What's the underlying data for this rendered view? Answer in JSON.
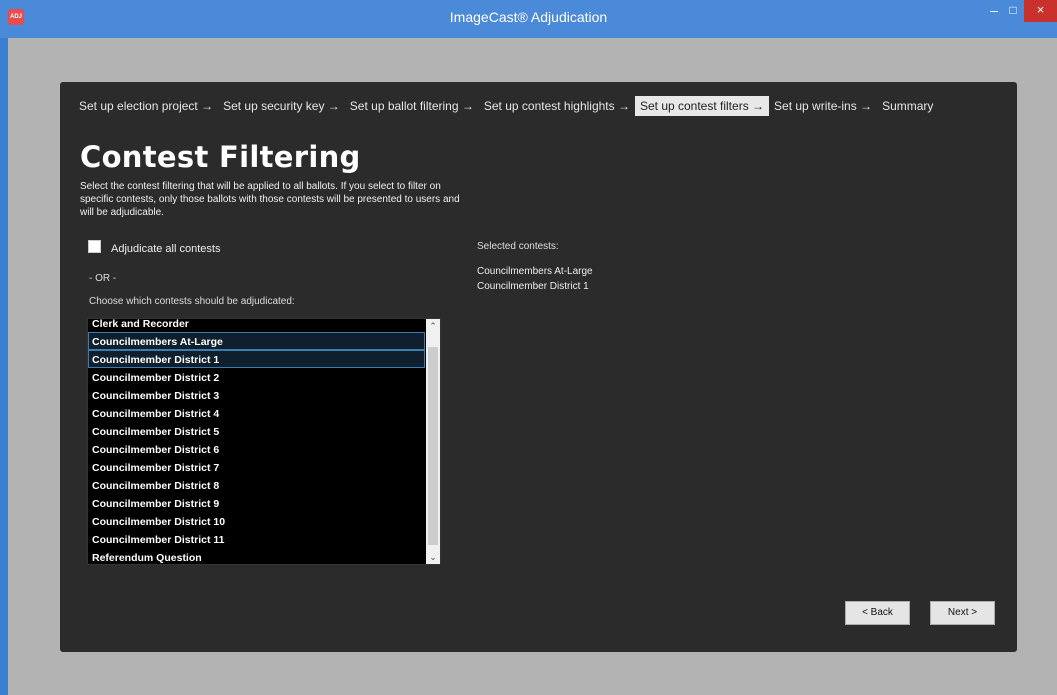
{
  "window": {
    "title": "ImageCast® Adjudication",
    "app_icon_text": "ADJ",
    "minimize": "–",
    "maximize": "□",
    "close": "×"
  },
  "steps": [
    {
      "label": "Set up election project →",
      "active": false
    },
    {
      "label": "Set up security key →",
      "active": false
    },
    {
      "label": "Set up ballot filtering →",
      "active": false
    },
    {
      "label": "Set up contest highlights →",
      "active": false
    },
    {
      "label": "Set up contest filters →",
      "active": true
    },
    {
      "label": "Set up write-ins →",
      "active": false
    },
    {
      "label": "Summary",
      "active": false
    }
  ],
  "page": {
    "heading": "Contest Filtering",
    "description": "Select the contest filtering that will be applied to all ballots. If you select to filter on specific contests, only those ballots with those contests will be presented to users and will be adjudicable.",
    "adjudicate_all_label": "Adjudicate all contests",
    "adjudicate_all_checked": false,
    "or_text": "- OR -",
    "choose_label": "Choose which contests should be adjudicated:"
  },
  "contests": [
    {
      "label": "Clerk and Recorder",
      "selected": false
    },
    {
      "label": "Councilmembers At-Large",
      "selected": true
    },
    {
      "label": "Councilmember District 1",
      "selected": true
    },
    {
      "label": "Councilmember District 2",
      "selected": false
    },
    {
      "label": "Councilmember District 3",
      "selected": false
    },
    {
      "label": "Councilmember District 4",
      "selected": false
    },
    {
      "label": "Councilmember District 5",
      "selected": false
    },
    {
      "label": "Councilmember District 6",
      "selected": false
    },
    {
      "label": "Councilmember District 7",
      "selected": false
    },
    {
      "label": "Councilmember District 8",
      "selected": false
    },
    {
      "label": "Councilmember District 9",
      "selected": false
    },
    {
      "label": "Councilmember District 10",
      "selected": false
    },
    {
      "label": "Councilmember District 11",
      "selected": false
    },
    {
      "label": "Referendum Question",
      "selected": false
    }
  ],
  "selected_panel": {
    "title": "Selected contests:",
    "items": [
      "Councilmembers At-Large",
      "Councilmember District 1"
    ]
  },
  "buttons": {
    "back": "< Back",
    "next": "Next >"
  }
}
